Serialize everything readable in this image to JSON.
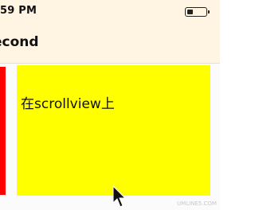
{
  "status_bar": {
    "time": "59 PM"
  },
  "nav_bar": {
    "title": "econd"
  },
  "content": {
    "scroll_view_label": "在scrollview上"
  },
  "colors": {
    "red_panel": "#ff0000",
    "scroll_view": "#ffff00",
    "bar_background": "#fff5e2"
  },
  "icons": {
    "battery": "battery-icon",
    "cursor": "cursor-icon"
  },
  "watermark": "UMLINE5.COM"
}
